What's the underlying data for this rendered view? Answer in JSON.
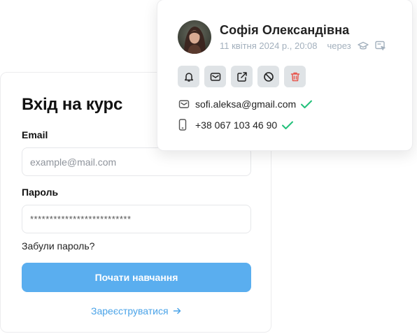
{
  "login": {
    "title": "Вхід на курс",
    "email_label": "Email",
    "email_placeholder": "example@mail.com",
    "password_label": "Пароль",
    "password_value": "**************************",
    "forgot_label": "Забули пароль?",
    "submit_label": "Почати навчання",
    "register_label": "Зареєструватися"
  },
  "profile": {
    "name": "Софія Олександівна",
    "date": "11 квітня 2024 р., 20:08",
    "via": "через",
    "email": "sofi.aleksa@gmail.com",
    "phone": "+38 067 103 46 90",
    "action_icons": [
      "bell-icon",
      "mail-icon",
      "external-link-icon",
      "block-icon",
      "trash-icon"
    ],
    "meta_icons": [
      "graduation-cap-icon",
      "login-form-icon"
    ]
  },
  "colors": {
    "primary_button": "#5aaeef",
    "link": "#4aa3e8",
    "verified": "#22c07a",
    "delete": "#e8584f",
    "action_bg": "#dfe3e6",
    "meta_text": "#a3b0bd"
  }
}
